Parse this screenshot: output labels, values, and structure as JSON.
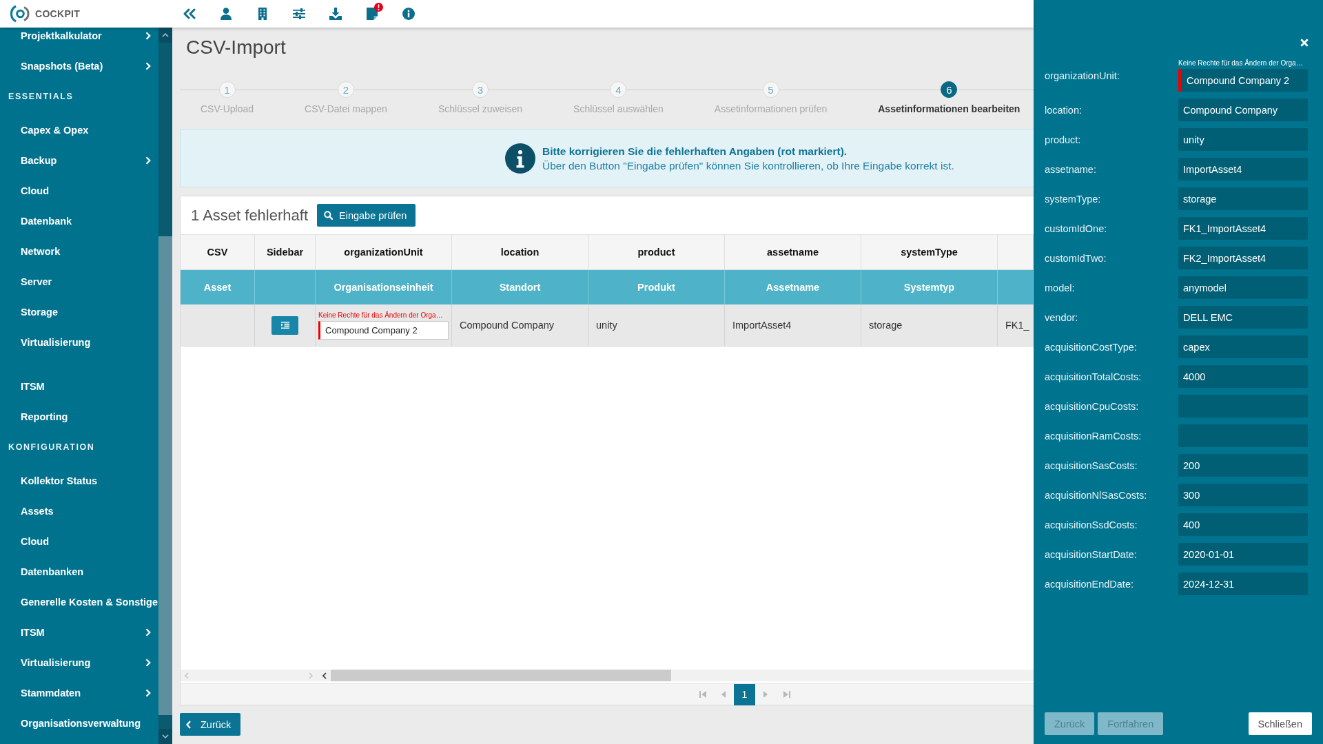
{
  "topbar": {
    "logo": "COCKPIT",
    "notification_alert": true
  },
  "sidebar": {
    "groups": [
      {
        "items": [
          {
            "label": "Projektkalkulator",
            "expandable": true,
            "selected": false
          },
          {
            "label": "Snapshots (Beta)",
            "expandable": true,
            "selected": false
          }
        ]
      },
      {
        "heading": "ESSENTIALS",
        "items": [
          {
            "label": "Capex & Opex",
            "expandable": false,
            "selected": false
          },
          {
            "label": "Backup",
            "expandable": true,
            "selected": false
          },
          {
            "label": "Cloud",
            "expandable": false,
            "selected": false
          },
          {
            "label": "Datenbank",
            "expandable": false,
            "selected": false
          },
          {
            "label": "Network",
            "expandable": false,
            "selected": false
          },
          {
            "label": "Server",
            "expandable": false,
            "selected": false
          },
          {
            "label": "Storage",
            "expandable": false,
            "selected": false
          },
          {
            "label": "Virtualisierung",
            "expandable": false,
            "selected": false
          }
        ]
      },
      {
        "items": [
          {
            "label": "ITSM",
            "expandable": false,
            "selected": false
          },
          {
            "label": "Reporting",
            "expandable": false,
            "selected": false
          }
        ]
      },
      {
        "heading": "KONFIGURATION",
        "items": [
          {
            "label": "Kollektor Status",
            "expandable": false,
            "selected": false
          },
          {
            "label": "Assets",
            "expandable": false,
            "selected": false
          },
          {
            "label": "Cloud",
            "expandable": false,
            "selected": false
          },
          {
            "label": "Datenbanken",
            "expandable": false,
            "selected": false
          },
          {
            "label": "Generelle Kosten & Sonstige",
            "expandable": false,
            "selected": false
          },
          {
            "label": "ITSM",
            "expandable": true,
            "selected": false
          },
          {
            "label": "Virtualisierung",
            "expandable": true,
            "selected": false
          },
          {
            "label": "Stammdaten",
            "expandable": true,
            "selected": false
          },
          {
            "label": "Organisationsverwaltung",
            "expandable": false,
            "selected": false
          }
        ]
      }
    ]
  },
  "page_title": "CSV-Import",
  "stepper": {
    "steps": [
      {
        "number": "1",
        "label": "CSV-Upload",
        "selected": false
      },
      {
        "number": "2",
        "label": "CSV-Datei mappen",
        "selected": false
      },
      {
        "number": "3",
        "label": "Schlüssel zuweisen",
        "selected": false
      },
      {
        "number": "4",
        "label": "Schlüssel auswählen",
        "selected": false
      },
      {
        "number": "5",
        "label": "Assetinformationen prüfen",
        "selected": false
      },
      {
        "number": "6",
        "label": "Assetinformationen bearbeiten",
        "selected": true
      }
    ]
  },
  "info_banner": {
    "title": "Bitte korrigieren Sie die fehlerhaften Angaben (rot markiert).",
    "message": "Über den Button \"Eingabe prüfen\" können Sie kontrollieren, ob Ihre Eingabe korrekt ist."
  },
  "results": {
    "title": "1 Asset fehlerhaft",
    "check_button": "Eingabe prüfen",
    "table": {
      "columns": [
        {
          "header": "CSV",
          "subheader": "Asset"
        },
        {
          "header": "Sidebar"
        },
        {
          "header": "organizationUnit",
          "subheader": "Organisationseinheit"
        },
        {
          "header": "location",
          "subheader": "Standort"
        },
        {
          "header": "product",
          "subheader": "Produkt"
        },
        {
          "header": "assetname",
          "subheader": "Assetname"
        },
        {
          "header": "systemType",
          "subheader": "Systemtyp"
        }
      ],
      "rows": [
        {
          "cells": [
            {
              "kind": "blank"
            },
            {
              "kind": "sidebar_button"
            },
            {
              "kind": "input",
              "value": "Compound Company 2",
              "invalid": true,
              "error": "Keine Rechte für das Ändern der Orga…"
            },
            {
              "kind": "text",
              "text": "Compound Company"
            },
            {
              "kind": "text",
              "text": "unity"
            },
            {
              "kind": "text",
              "text": "ImportAsset4"
            },
            {
              "kind": "text",
              "text": "storage"
            },
            {
              "kind": "text",
              "text": "FK1_"
            }
          ]
        }
      ]
    },
    "pagination": {
      "pages": [
        {
          "label": "1",
          "selected": true
        }
      ]
    }
  },
  "back_button": "Zurück",
  "detail_panel": {
    "fields": [
      {
        "label": "organizationUnit:",
        "value": "Compound Company 2",
        "invalid": true,
        "error": "Keine Rechte für das Ändern der Orga…"
      },
      {
        "label": "location:",
        "value": "Compound Company",
        "invalid": false
      },
      {
        "label": "product:",
        "value": "unity",
        "invalid": false
      },
      {
        "label": "assetname:",
        "value": "ImportAsset4",
        "invalid": false
      },
      {
        "label": "systemType:",
        "value": "storage",
        "invalid": false
      },
      {
        "label": "customIdOne:",
        "value": "FK1_ImportAsset4",
        "invalid": false
      },
      {
        "label": "customIdTwo:",
        "value": "FK2_ImportAsset4",
        "invalid": false
      },
      {
        "label": "model:",
        "value": "anymodel",
        "invalid": false
      },
      {
        "label": "vendor:",
        "value": "DELL EMC",
        "invalid": false
      },
      {
        "label": "acquisitionCostType:",
        "value": "capex",
        "invalid": false
      },
      {
        "label": "acquisitionTotalCosts:",
        "value": "4000",
        "invalid": false
      },
      {
        "label": "acquisitionCpuCosts:",
        "invalid": false
      },
      {
        "label": "acquisitionRamCosts:",
        "invalid": false
      },
      {
        "label": "acquisitionSasCosts:",
        "value": "200",
        "invalid": false
      },
      {
        "label": "acquisitionNlSasCosts:",
        "value": "300",
        "invalid": false
      },
      {
        "label": "acquisitionSsdCosts:",
        "value": "400",
        "invalid": false
      },
      {
        "label": "acquisitionStartDate:",
        "value": "2020-01-01",
        "invalid": false
      },
      {
        "label": "acquisitionEndDate:",
        "value": "2024-12-31",
        "invalid": false
      }
    ],
    "buttons": [
      {
        "label": "Zurück",
        "disabled": true
      },
      {
        "label": "Fortfahren",
        "disabled": true
      },
      {
        "label": "Schließen",
        "disabled": false
      }
    ]
  }
}
